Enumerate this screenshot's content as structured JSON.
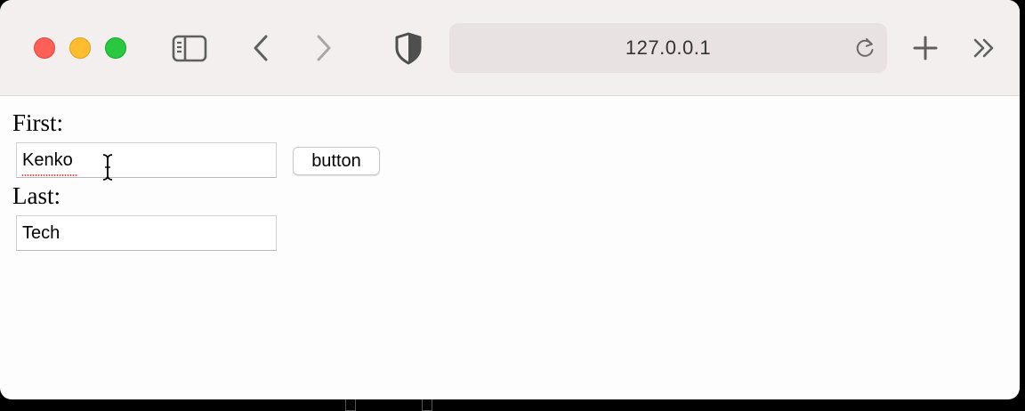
{
  "browser": {
    "address": "127.0.0.1",
    "icons": {
      "sidebar": "sidebar-icon",
      "back": "chevron-left-icon",
      "forward": "chevron-right-icon",
      "privacy": "shield-icon",
      "reload": "reload-icon",
      "new_tab": "plus-icon",
      "more": "double-chevron-right-icon"
    },
    "colors": {
      "close": "#fe5f57",
      "minimize": "#febc2e",
      "maximize": "#28c840",
      "toolbar": "#f2efee",
      "address_bg": "#e8e3e2"
    }
  },
  "form": {
    "first_label": "First:",
    "first_value": "Kenko",
    "button_label": "button",
    "last_label": "Last:",
    "last_value": "Tech"
  }
}
